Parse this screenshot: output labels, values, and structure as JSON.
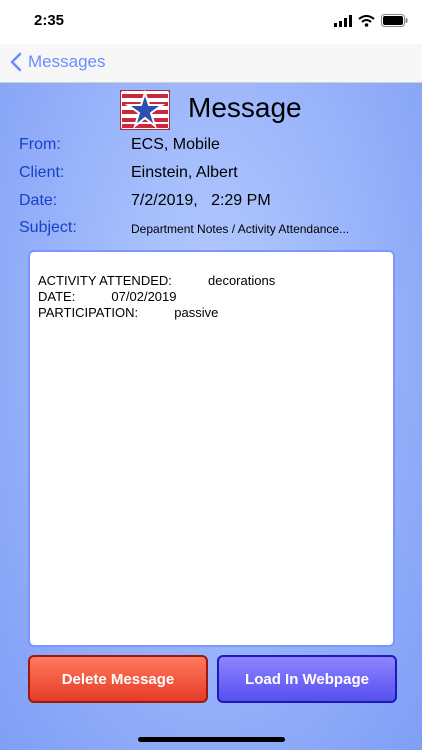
{
  "status": {
    "time": "2:35"
  },
  "nav": {
    "back_label": "Messages"
  },
  "header": {
    "title": "Message"
  },
  "fields": [
    {
      "label": "From:",
      "value": "ECS, Mobile"
    },
    {
      "label": "Client:",
      "value": "Einstein, Albert"
    },
    {
      "label": "Date:",
      "value": "7/2/2019,   2:29 PM"
    },
    {
      "label": "Subject:",
      "value": "Department Notes / Activity  Attendance..."
    }
  ],
  "message": {
    "lines": [
      "ACTIVITY ATTENDED:          decorations",
      "DATE:          07/02/2019",
      "PARTICIPATION:          passive"
    ]
  },
  "buttons": {
    "delete_label": "Delete Message",
    "load_label": "Load In Webpage"
  },
  "colors": {
    "label": "#1b40c8",
    "accent": "#6b8cff",
    "delete": "#e53b27",
    "load": "#5650ef"
  }
}
